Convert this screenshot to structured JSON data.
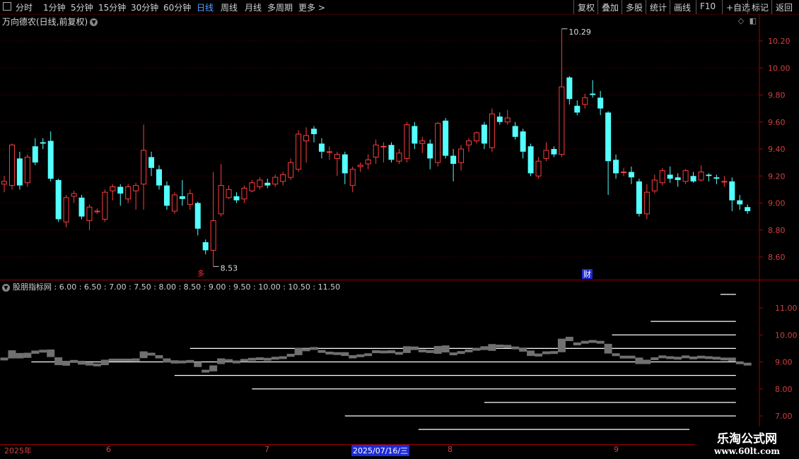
{
  "toolbar": {
    "periods": [
      "分时",
      "1分钟",
      "5分钟",
      "15分钟",
      "30分钟",
      "60分钟",
      "日线",
      "周线",
      "月线",
      "多周期",
      "更多 >"
    ],
    "active_period": "日线",
    "right_buttons": [
      "复权",
      "叠加",
      "多股",
      "统计",
      "画线",
      "F10",
      "+自选",
      "标记",
      "返回"
    ]
  },
  "main_title": "万向德农(日线,前复权)",
  "indicator_title": "股朋指标网 : 6.00 : 6.50 : 7.00 : 7.50 : 8.00 : 8.50 : 9.00 : 9.50 : 10.00 : 10.50 : 11.50",
  "annotations": {
    "high_label": "10.29",
    "low_label": "8.53",
    "fin_marker": "财",
    "left_marker": "多"
  },
  "x_axis": {
    "labels": [
      "2025年",
      "6",
      "7",
      "8",
      "9"
    ],
    "cursor_date": "2025/07/16/三"
  },
  "watermark": {
    "brand": "乐淘公式网",
    "url": "www.60lt.com"
  },
  "colors": {
    "up": "#ff3c3c",
    "down": "#54ffff",
    "axis": "#a00000",
    "bg": "#000000",
    "grid": "#5a0000"
  },
  "chart_data": {
    "type": "candlestick",
    "price_axis": {
      "ticks": [
        8.6,
        8.8,
        9.0,
        9.2,
        9.4,
        9.6,
        9.8,
        10.0,
        10.2
      ],
      "range": [
        8.47,
        10.35
      ]
    },
    "candles": [
      [
        9.14,
        9.16,
        9.2,
        9.08
      ],
      [
        9.13,
        9.43,
        9.44,
        9.1
      ],
      [
        9.33,
        9.13,
        9.38,
        9.1
      ],
      [
        9.15,
        9.34,
        9.36,
        9.12
      ],
      [
        9.42,
        9.3,
        9.48,
        9.28
      ],
      [
        9.45,
        9.44,
        9.48,
        9.4
      ],
      [
        9.46,
        9.18,
        9.53,
        9.16
      ],
      [
        9.17,
        8.88,
        9.18,
        8.86
      ],
      [
        8.86,
        9.04,
        9.06,
        8.82
      ],
      [
        9.05,
        9.07,
        9.09,
        9.0
      ],
      [
        9.04,
        8.9,
        9.06,
        8.88
      ],
      [
        8.87,
        8.97,
        8.99,
        8.8
      ],
      [
        8.94,
        8.94,
        8.96,
        8.92
      ],
      [
        8.88,
        9.08,
        9.1,
        8.86
      ],
      [
        9.09,
        9.12,
        9.14,
        9.02
      ],
      [
        9.12,
        9.07,
        9.14,
        8.98
      ],
      [
        9.03,
        9.12,
        9.14,
        9.0
      ],
      [
        9.09,
        9.13,
        9.15,
        8.95
      ],
      [
        9.14,
        9.39,
        9.58,
        8.95
      ],
      [
        9.34,
        9.26,
        9.38,
        9.2
      ],
      [
        9.25,
        9.13,
        9.28,
        9.1
      ],
      [
        9.13,
        8.98,
        9.16,
        8.95
      ],
      [
        8.94,
        9.06,
        9.08,
        8.92
      ],
      [
        9.05,
        9.03,
        9.17,
        8.98
      ],
      [
        8.99,
        9.07,
        9.1,
        8.95
      ],
      [
        9.0,
        8.81,
        9.01,
        8.76
      ],
      [
        8.71,
        8.65,
        8.73,
        8.62
      ],
      [
        8.65,
        8.87,
        9.23,
        8.53
      ],
      [
        8.92,
        9.13,
        9.29,
        8.9
      ],
      [
        9.04,
        9.1,
        9.13,
        9.03
      ],
      [
        9.05,
        9.02,
        9.08,
        9.0
      ],
      [
        9.03,
        9.11,
        9.13,
        9.0
      ],
      [
        9.09,
        9.15,
        9.17,
        9.08
      ],
      [
        9.12,
        9.17,
        9.19,
        9.1
      ],
      [
        9.15,
        9.13,
        9.18,
        9.11
      ],
      [
        9.14,
        9.19,
        9.21,
        9.12
      ],
      [
        9.16,
        9.21,
        9.23,
        9.13
      ],
      [
        9.19,
        9.3,
        9.33,
        9.17
      ],
      [
        9.25,
        9.51,
        9.54,
        9.23
      ],
      [
        9.46,
        9.5,
        9.56,
        9.3
      ],
      [
        9.55,
        9.51,
        9.57,
        9.45
      ],
      [
        9.44,
        9.38,
        9.48,
        9.33
      ],
      [
        9.38,
        9.38,
        9.42,
        9.32
      ],
      [
        9.33,
        9.36,
        9.38,
        9.2
      ],
      [
        9.36,
        9.22,
        9.38,
        9.14
      ],
      [
        9.13,
        9.25,
        9.27,
        9.08
      ],
      [
        9.27,
        9.28,
        9.3,
        9.23
      ],
      [
        9.29,
        9.32,
        9.36,
        9.25
      ],
      [
        9.34,
        9.43,
        9.47,
        9.29
      ],
      [
        9.42,
        9.42,
        9.45,
        9.3
      ],
      [
        9.43,
        9.32,
        9.45,
        9.3
      ],
      [
        9.31,
        9.37,
        9.4,
        9.29
      ],
      [
        9.33,
        9.58,
        9.6,
        9.3
      ],
      [
        9.57,
        9.44,
        9.6,
        9.4
      ],
      [
        9.44,
        9.46,
        9.49,
        9.37
      ],
      [
        9.44,
        9.33,
        9.47,
        9.25
      ],
      [
        9.3,
        9.59,
        9.6,
        9.27
      ],
      [
        9.61,
        9.35,
        9.63,
        9.33
      ],
      [
        9.35,
        9.29,
        9.4,
        9.16
      ],
      [
        9.3,
        9.4,
        9.43,
        9.24
      ],
      [
        9.43,
        9.46,
        9.48,
        9.38
      ],
      [
        9.46,
        9.52,
        9.53,
        9.44
      ],
      [
        9.58,
        9.44,
        9.6,
        9.4
      ],
      [
        9.41,
        9.66,
        9.7,
        9.38
      ],
      [
        9.64,
        9.6,
        9.67,
        9.58
      ],
      [
        9.6,
        9.63,
        9.69,
        9.58
      ],
      [
        9.57,
        9.49,
        9.6,
        9.47
      ],
      [
        9.53,
        9.38,
        9.55,
        9.33
      ],
      [
        9.42,
        9.22,
        9.44,
        9.2
      ],
      [
        9.2,
        9.31,
        9.34,
        9.18
      ],
      [
        9.33,
        9.39,
        9.45,
        9.31
      ],
      [
        9.4,
        9.36,
        9.42,
        9.34
      ],
      [
        9.36,
        9.86,
        10.29,
        9.34
      ],
      [
        9.93,
        9.77,
        9.94,
        9.73
      ],
      [
        9.72,
        9.67,
        9.76,
        9.65
      ],
      [
        9.73,
        9.78,
        9.81,
        9.7
      ],
      [
        9.81,
        9.8,
        9.91,
        9.78
      ],
      [
        9.78,
        9.7,
        9.83,
        9.65
      ],
      [
        9.67,
        9.31,
        9.68,
        9.06
      ],
      [
        9.32,
        9.22,
        9.36,
        9.18
      ],
      [
        9.23,
        9.23,
        9.26,
        9.2
      ],
      [
        9.23,
        9.19,
        9.27,
        9.14
      ],
      [
        9.16,
        8.92,
        9.18,
        8.9
      ],
      [
        8.92,
        9.08,
        9.14,
        8.88
      ],
      [
        9.09,
        9.17,
        9.21,
        9.07
      ],
      [
        9.15,
        9.24,
        9.26,
        9.13
      ],
      [
        9.21,
        9.18,
        9.27,
        9.15
      ],
      [
        9.19,
        9.17,
        9.22,
        9.12
      ],
      [
        9.16,
        9.24,
        9.25,
        9.14
      ],
      [
        9.2,
        9.16,
        9.23,
        9.15
      ],
      [
        9.17,
        9.23,
        9.28,
        9.16
      ],
      [
        9.21,
        9.2,
        9.22,
        9.16
      ],
      [
        9.19,
        9.18,
        9.21,
        9.14
      ],
      [
        9.16,
        9.16,
        9.2,
        9.12
      ],
      [
        9.16,
        9.02,
        9.19,
        8.94
      ],
      [
        9.02,
        8.99,
        9.06,
        8.95
      ],
      [
        8.97,
        8.94,
        8.99,
        8.92
      ]
    ],
    "indicator": {
      "axis_ticks": [
        7.0,
        8.0,
        9.0,
        10.0,
        11.0
      ],
      "range": [
        6.45,
        11.75
      ],
      "lines": [
        {
          "level": 11.5,
          "from": 92.5,
          "to": 94.5
        },
        {
          "level": 10.5,
          "from": 83.5,
          "to": 94.5
        },
        {
          "level": 10.0,
          "from": 78.5,
          "to": 94.5
        },
        {
          "level": 9.5,
          "from": 24.0,
          "to": 94.5
        },
        {
          "level": 9.0,
          "from": 3.5,
          "to": 94.5
        },
        {
          "level": 8.5,
          "from": 22.0,
          "to": 94.5
        },
        {
          "level": 8.0,
          "from": 32.0,
          "to": 94.5
        },
        {
          "level": 7.5,
          "from": 62.0,
          "to": 94.5
        },
        {
          "level": 7.0,
          "from": 44.0,
          "to": 94.5
        },
        {
          "level": 6.5,
          "from": 53.5,
          "to": 88.5
        }
      ]
    }
  }
}
